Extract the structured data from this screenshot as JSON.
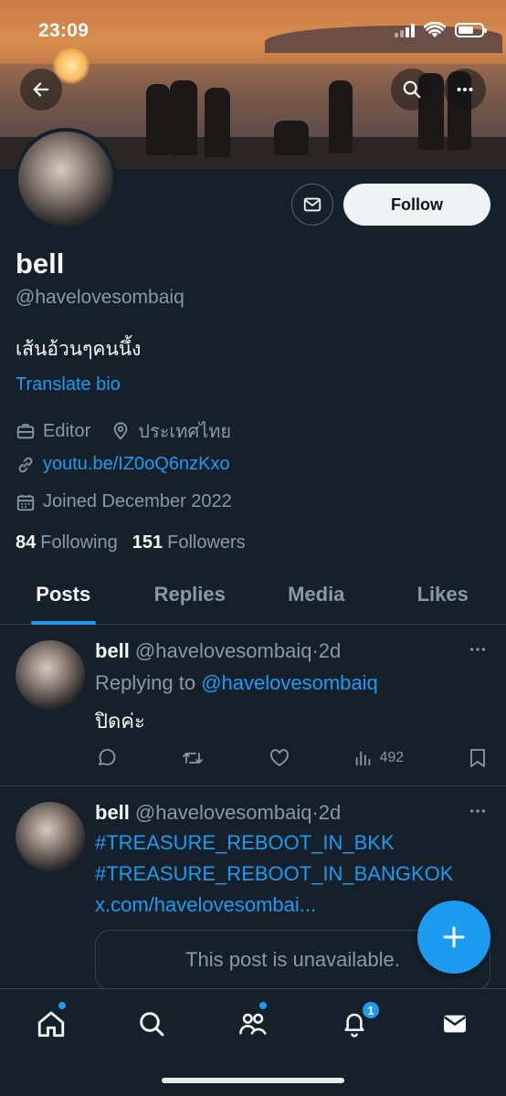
{
  "status": {
    "time": "23:09"
  },
  "profile": {
    "name": "bell",
    "handle": "@havelovesombaiq",
    "bio": "เส้นอ้วนๆคนนึ้ง",
    "translate_label": "Translate bio",
    "category": "Editor",
    "location": "ประเทศไทย",
    "link": "youtu.be/IZ0oQ6nzKxo",
    "joined": "Joined December 2022",
    "following_count": "84",
    "following_label": "Following",
    "followers_count": "151",
    "followers_label": "Followers",
    "follow_button": "Follow"
  },
  "tabs": [
    {
      "label": "Posts",
      "active": true
    },
    {
      "label": "Replies"
    },
    {
      "label": "Media"
    },
    {
      "label": "Likes"
    }
  ],
  "posts": [
    {
      "name": "bell",
      "handle": "@havelovesombaiq",
      "time": "·2d",
      "replying_prefix": "Replying to",
      "replying_to": "@havelovesombaiq",
      "text": "ปิดค่ะ",
      "views": "492"
    },
    {
      "name": "bell",
      "handle": "@havelovesombaiq",
      "time": "·2d",
      "lines": [
        "#TREASURE_REBOOT_IN_BKK",
        "#TREASURE_REBOOT_IN_BANGKOK",
        "x.com/havelovesombai..."
      ],
      "quoted": "This post is unavailable."
    }
  ],
  "nav": {
    "notifications_badge": "1"
  },
  "colors": {
    "accent": "#1d9bf0",
    "background": "#15202b",
    "muted": "#8b98a5"
  }
}
